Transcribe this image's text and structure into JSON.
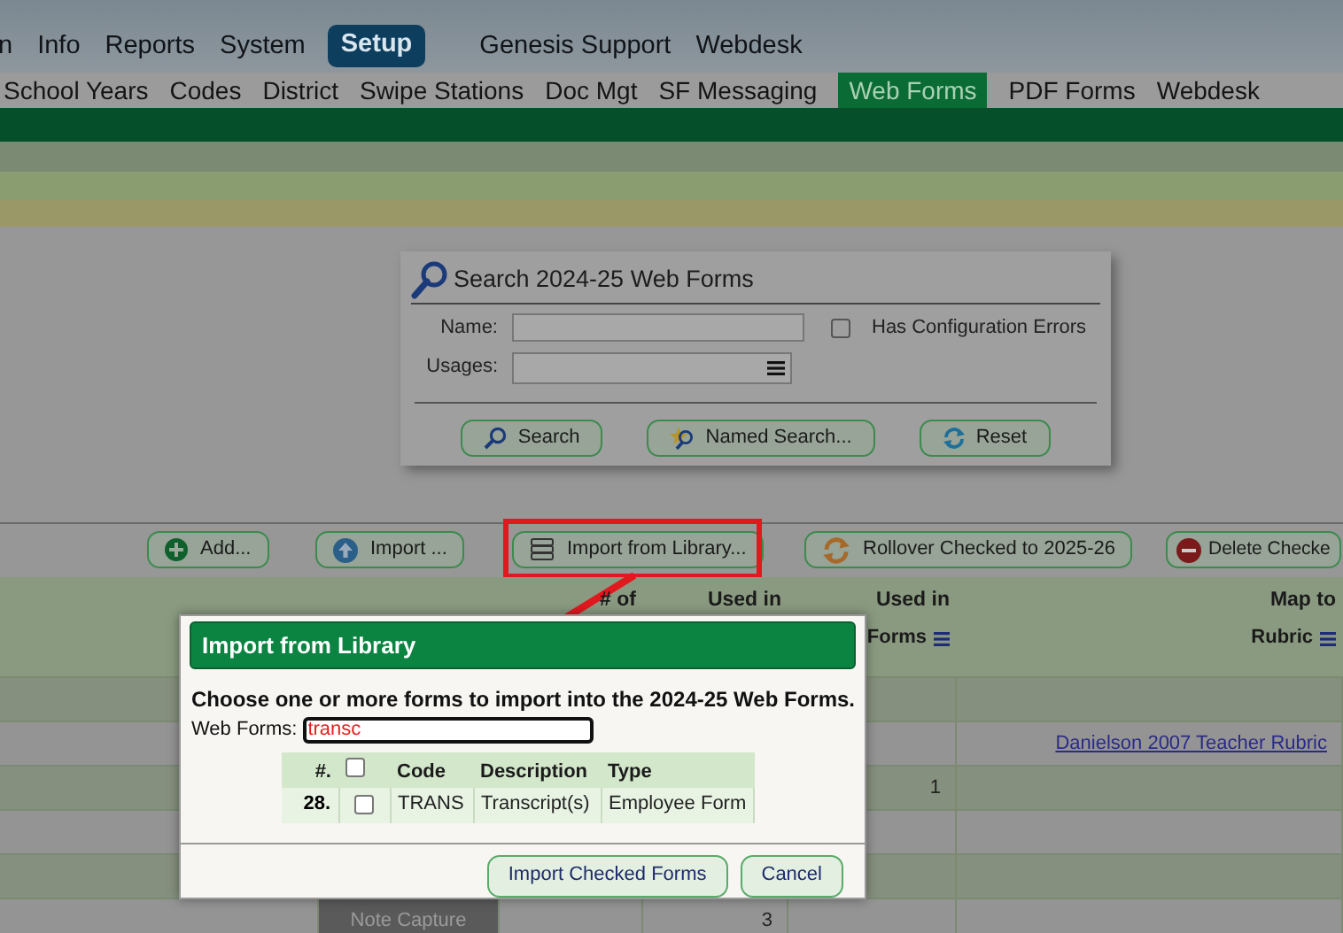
{
  "top_nav": [
    {
      "label": "n",
      "selected": false
    },
    {
      "label": "Info",
      "selected": false
    },
    {
      "label": "Reports",
      "selected": false
    },
    {
      "label": "System",
      "selected": false
    },
    {
      "label": "Setup",
      "selected": true
    },
    {
      "label": "Genesis Support",
      "selected": false
    },
    {
      "label": "Webdesk",
      "selected": false
    }
  ],
  "sub_tabs": [
    {
      "label": "School Years",
      "selected": false
    },
    {
      "label": "Codes",
      "selected": false
    },
    {
      "label": "District",
      "selected": false
    },
    {
      "label": "Swipe Stations",
      "selected": false
    },
    {
      "label": "Doc Mgt",
      "selected": false
    },
    {
      "label": "SF Messaging",
      "selected": false
    },
    {
      "label": "Web Forms",
      "selected": true
    },
    {
      "label": "PDF Forms",
      "selected": false
    },
    {
      "label": "Webdesk",
      "selected": false
    }
  ],
  "search_panel": {
    "title": "Search 2024-25 Web Forms",
    "name_label": "Name:",
    "config_errors": {
      "label": "Has Configuration Errors",
      "checked": false
    },
    "usages_label": "Usages:",
    "buttons": [
      {
        "label": "Search",
        "kind": "search"
      },
      {
        "label": "Named Search...",
        "kind": "named"
      },
      {
        "label": "Reset",
        "kind": "reset"
      }
    ]
  },
  "toolbar": [
    {
      "label": "Add...",
      "kind": "add",
      "highlighted": false
    },
    {
      "label": "Import ...",
      "kind": "upload",
      "highlighted": false
    },
    {
      "label": "Import from Library...",
      "kind": "library",
      "highlighted": true
    },
    {
      "label": "Rollover Checked to 2025-26",
      "kind": "rollover",
      "highlighted": false
    },
    {
      "label": "Delete Checke",
      "kind": "delete",
      "highlighted": false
    }
  ],
  "table": {
    "headers": [
      {
        "lines": [
          "# of"
        ],
        "menu": false
      },
      {
        "lines": [
          "Used in"
        ],
        "menu": false
      },
      {
        "lines": [
          "Used in",
          "Forms"
        ],
        "menu": true
      },
      {
        "lines": [
          "Map to",
          "Rubric"
        ],
        "menu": true
      }
    ],
    "rows": [
      {},
      {
        "rubric": "Danielson 2007 Teacher Rubric"
      },
      {
        "used_in_forms": "1"
      },
      {},
      {},
      {
        "name": "Note Capture",
        "used_in_workflows": "3"
      }
    ]
  },
  "dialog": {
    "title": "Import from Library",
    "instructions": "Choose one or more forms to import into the 2024-25 Web Forms.",
    "filter_label": "Web Forms:",
    "filter_value": "transc",
    "columns": [
      "#.",
      "Code",
      "Description",
      "Type"
    ],
    "select_all_checked": false,
    "rows": [
      {
        "number": "28.",
        "checked": false,
        "code": "TRANS",
        "description": "Transcript(s)",
        "type": "Employee Form"
      }
    ],
    "buttons": [
      "Import Checked Forms",
      "Cancel"
    ]
  }
}
